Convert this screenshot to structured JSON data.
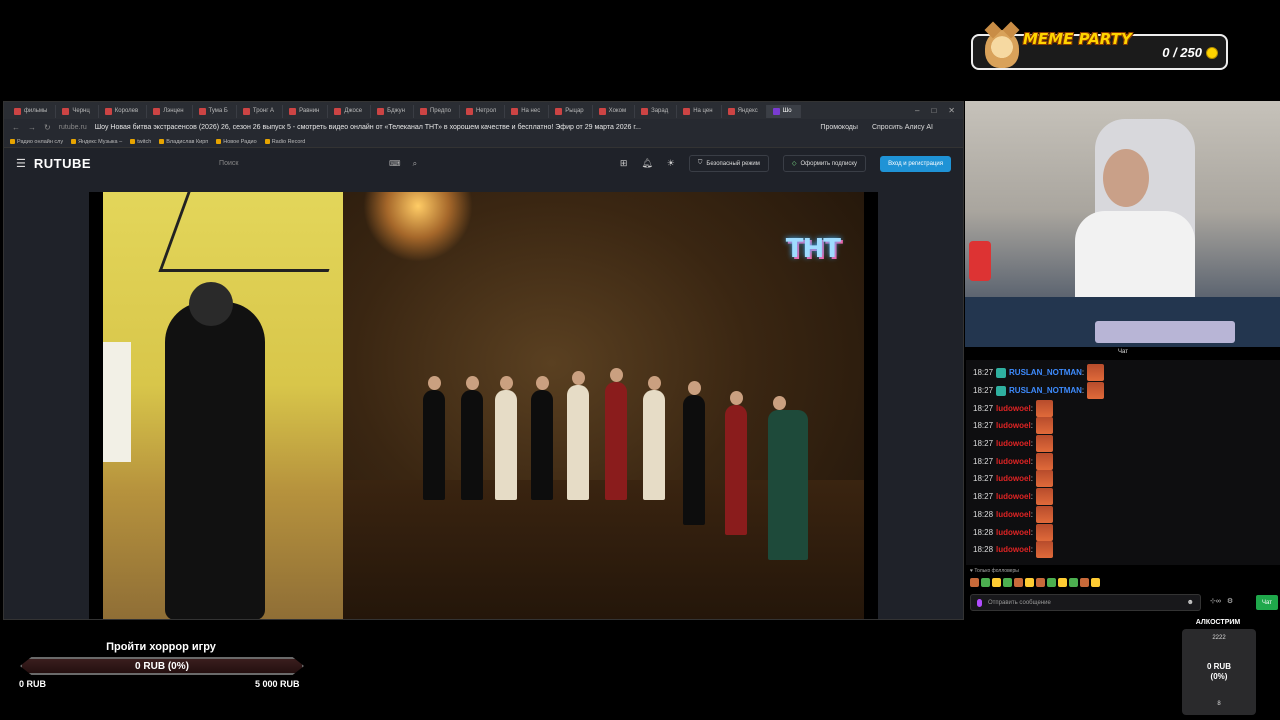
{
  "meme_party": {
    "title": "MEME PARTY",
    "score": "0 / 250"
  },
  "browser": {
    "tabs": [
      "фильмы",
      "Чернц",
      "Королев",
      "Лэнцен",
      "Тума Б",
      "Тронг А",
      "Равнин",
      "Джосе",
      "Бджун",
      "Предпо",
      "Нетрол",
      "На нес",
      "Рыцар",
      "Хоком",
      "Зарад",
      "На цен",
      "Яндекс",
      "Шо"
    ],
    "url_domain": "rutube.ru",
    "page_title": "Шоу Новая битва экстрасенсов (2026) 26, сезон 26 выпуск 5 - смотреть видео онлайн от «Телеканал ТНТ» в хорошем качестве и бесплатно! Эфир от 29 марта 2026 г...",
    "promo_codes": "Промокоды",
    "ask_alice": "Спросить Алису AI",
    "bookmarks": [
      "Радио онлайн слу",
      "Яндекс Музыка –",
      "twitch",
      "Владислав Кирп",
      "Новое Радио",
      "Radio Record"
    ]
  },
  "rutube": {
    "logo": "RUTUBE",
    "search_placeholder": "Поиск",
    "safe_mode": "Безопасный режим",
    "subscribe": "Оформить подписку",
    "login": "Вход и регистрация",
    "channel_logo": "ТНТ"
  },
  "chat": {
    "label": "Чат",
    "messages": [
      {
        "time": "18:27",
        "user": "RUSLAN_NOTMAN",
        "color": "#3e8cff"
      },
      {
        "time": "18:27",
        "user": "RUSLAN_NOTMAN",
        "color": "#3e8cff"
      },
      {
        "time": "18:27",
        "user": "ludowoel",
        "color": "#e02424"
      },
      {
        "time": "18:27",
        "user": "ludowoel",
        "color": "#e02424"
      },
      {
        "time": "18:27",
        "user": "ludowoel",
        "color": "#e02424"
      },
      {
        "time": "18:27",
        "user": "ludowoel",
        "color": "#e02424"
      },
      {
        "time": "18:27",
        "user": "ludowoel",
        "color": "#e02424"
      },
      {
        "time": "18:27",
        "user": "ludowoel",
        "color": "#e02424"
      },
      {
        "time": "18:28",
        "user": "ludowoel",
        "color": "#e02424"
      },
      {
        "time": "18:28",
        "user": "ludowoel",
        "color": "#e02424"
      },
      {
        "time": "18:28",
        "user": "ludowoel",
        "color": "#e02424"
      }
    ],
    "followers_only": "Только фолловеры",
    "input_placeholder": "Отправить сообщение",
    "send": "Чат"
  },
  "goal": {
    "title": "Пройти хоррор игру",
    "current": "0 RUB (0%)",
    "progress": 0,
    "min": "0 RUB",
    "max": "5 000 RUB"
  },
  "alkostream": {
    "title": "АЛКОСТРИМ",
    "top": "2222",
    "value": "0 RUB\n(0%)",
    "bottom": "8"
  }
}
